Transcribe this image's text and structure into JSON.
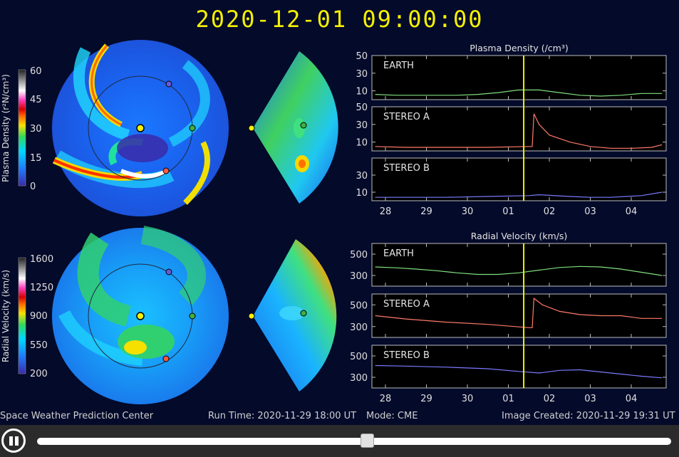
{
  "timestamp": "2020-12-01  09:00:00",
  "colors": {
    "earth": "#7fe07f",
    "stereo_a": "#ff7a6a",
    "stereo_b": "#7a7aff",
    "marker": "#f4f000",
    "background": "#040a2a"
  },
  "density_colorbar": {
    "label": "Plasma Density (r²N/cm³)",
    "ticks": [
      "60",
      "45",
      "30",
      "15",
      "0"
    ]
  },
  "velocity_colorbar": {
    "label": "Radial Velocity (km/s)",
    "ticks": [
      "1600",
      "1250",
      "900",
      "550",
      "200"
    ]
  },
  "chart_data": [
    {
      "type": "line",
      "title": "Plasma Density (/cm³)",
      "x_ticks": [
        "28",
        "29",
        "30",
        "01",
        "02",
        "03",
        "04"
      ],
      "current_time_marker": "01 09:00",
      "panels": [
        {
          "name": "EARTH",
          "y_ticks": [
            "50",
            "30",
            "10"
          ],
          "ylim": [
            0,
            50
          ],
          "x": [
            "27 18:00",
            "28 06:00",
            "28 18:00",
            "29 06:00",
            "29 18:00",
            "30 06:00",
            "30 18:00",
            "01 06:00",
            "01 18:00",
            "02 06:00",
            "02 18:00",
            "03 06:00",
            "03 18:00",
            "04 06:00",
            "04 18:00"
          ],
          "values": [
            6,
            5,
            5,
            5,
            5,
            6,
            8,
            11,
            11,
            8,
            5,
            4,
            5,
            7,
            7
          ]
        },
        {
          "name": "STEREO A",
          "y_ticks": [
            "50",
            "30",
            "10"
          ],
          "ylim": [
            0,
            50
          ],
          "x": [
            "27 18:00",
            "28 12:00",
            "29 12:00",
            "30 12:00",
            "01 12:00",
            "01 14:00",
            "01 15:00",
            "01 18:00",
            "02 00:00",
            "02 12:00",
            "03 00:00",
            "03 12:00",
            "04 00:00",
            "04 12:00",
            "04 18:00"
          ],
          "values": [
            5,
            4,
            4,
            4,
            5,
            5,
            42,
            30,
            18,
            10,
            5,
            3,
            3,
            4,
            7
          ]
        },
        {
          "name": "STEREO B",
          "y_ticks": [
            "30",
            "10"
          ],
          "ylim": [
            0,
            50
          ],
          "x": [
            "27 18:00",
            "28 12:00",
            "29 12:00",
            "30 12:00",
            "01 12:00",
            "01 18:00",
            "02 12:00",
            "03 00:00",
            "03 12:00",
            "04 06:00",
            "04 18:00"
          ],
          "values": [
            4,
            4,
            4,
            5,
            6,
            7,
            5,
            4,
            4,
            6,
            10
          ]
        }
      ]
    },
    {
      "type": "line",
      "title": "Radial Velocity (km/s)",
      "x_ticks": [
        "28",
        "29",
        "30",
        "01",
        "02",
        "03",
        "04"
      ],
      "current_time_marker": "01 09:00",
      "panels": [
        {
          "name": "EARTH",
          "y_ticks": [
            "500",
            "300"
          ],
          "ylim": [
            200,
            600
          ],
          "x": [
            "27 18:00",
            "28 06:00",
            "28 18:00",
            "29 06:00",
            "29 18:00",
            "30 06:00",
            "30 18:00",
            "01 06:00",
            "01 18:00",
            "02 06:00",
            "02 18:00",
            "03 06:00",
            "03 18:00",
            "04 06:00",
            "04 18:00"
          ],
          "values": [
            380,
            372,
            360,
            345,
            325,
            310,
            310,
            325,
            350,
            375,
            385,
            380,
            360,
            330,
            300
          ]
        },
        {
          "name": "STEREO A",
          "y_ticks": [
            "500",
            "300"
          ],
          "ylim": [
            200,
            600
          ],
          "x": [
            "27 18:00",
            "28 12:00",
            "29 12:00",
            "30 12:00",
            "01 12:00",
            "01 14:00",
            "01 15:00",
            "01 20:00",
            "02 06:00",
            "02 18:00",
            "03 06:00",
            "03 18:00",
            "04 06:00",
            "04 18:00"
          ],
          "values": [
            400,
            370,
            340,
            320,
            290,
            290,
            560,
            500,
            440,
            410,
            400,
            400,
            375,
            375
          ]
        },
        {
          "name": "STEREO B",
          "y_ticks": [
            "500",
            "300"
          ],
          "ylim": [
            200,
            600
          ],
          "x": [
            "27 18:00",
            "28 12:00",
            "29 12:00",
            "30 12:00",
            "01 06:00",
            "01 18:00",
            "02 06:00",
            "02 18:00",
            "03 06:00",
            "03 18:00",
            "04 06:00",
            "04 18:00"
          ],
          "values": [
            410,
            405,
            395,
            380,
            355,
            340,
            365,
            370,
            350,
            330,
            310,
            295
          ]
        }
      ]
    }
  ],
  "footer": {
    "left": "Space Weather Prediction Center",
    "run_time": "Run Time: 2020-11-29 18:00 UT",
    "mode": "Mode: CME",
    "created": "Image Created: 2020-11-29 19:31 UT"
  },
  "controls": {
    "play_state": "pause",
    "slider_position": 0.52
  }
}
